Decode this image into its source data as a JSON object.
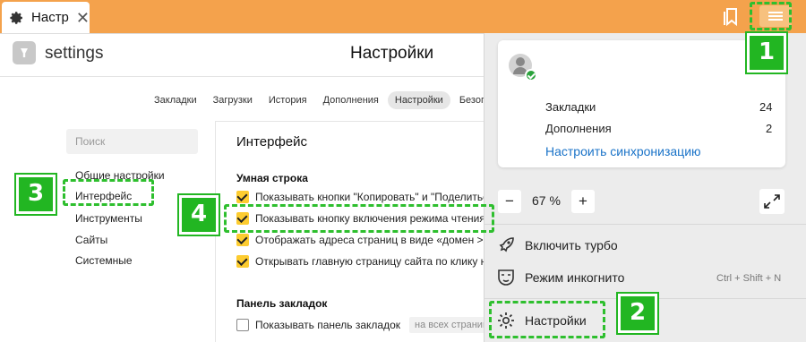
{
  "tab": {
    "title": "Настр",
    "close": "✕"
  },
  "header": {
    "address": "settings",
    "title": "Настройки"
  },
  "nav_tabs": [
    {
      "label": "Закладки"
    },
    {
      "label": "Загрузки"
    },
    {
      "label": "История"
    },
    {
      "label": "Дополнения"
    },
    {
      "label": "Настройки",
      "active": true
    },
    {
      "label": "Безопасно"
    }
  ],
  "sidebar": {
    "search_placeholder": "Поиск",
    "items": [
      "Общие настройки",
      "Интерфейс",
      "Инструменты",
      "Сайты",
      "Системные"
    ]
  },
  "panel": {
    "title": "Интерфейс",
    "smart_line": {
      "title": "Умная строка",
      "options": [
        {
          "label": "Показывать кнопки \"Копировать\" и \"Поделиться\"",
          "checked": true
        },
        {
          "label": "Показывать кнопку включения режима чтения",
          "checked": true
        },
        {
          "label": "Отображать адреса страниц в виде «домен > заг",
          "checked": true
        },
        {
          "label": "Открывать главную страницу сайта по клику на е",
          "checked": true
        }
      ]
    },
    "bookmarks_bar": {
      "title": "Панель закладок",
      "option": {
        "label": "Показывать панель закладок",
        "checked": false
      },
      "dropdown": "на всех страницах"
    }
  },
  "menu": {
    "card": {
      "bookmarks_label": "Закладки",
      "bookmarks_count": "24",
      "extensions_label": "Дополнения",
      "extensions_count": "2",
      "sync_link": "Настроить синхронизацию"
    },
    "zoom": {
      "minus": "−",
      "value": "67 %",
      "plus": "+"
    },
    "items": {
      "turbo": "Включить турбо",
      "incognito": "Режим инкогнито",
      "incognito_shortcut": "Ctrl + Shift + N",
      "settings": "Настройки"
    }
  },
  "callouts": {
    "n1": "1",
    "n2": "2",
    "n3": "3",
    "n4": "4"
  },
  "colors": {
    "accent_orange": "#f4a24c",
    "checkbox_yellow": "#fdcc30",
    "callout_green": "#22b622",
    "link_blue": "#1a73c8"
  }
}
